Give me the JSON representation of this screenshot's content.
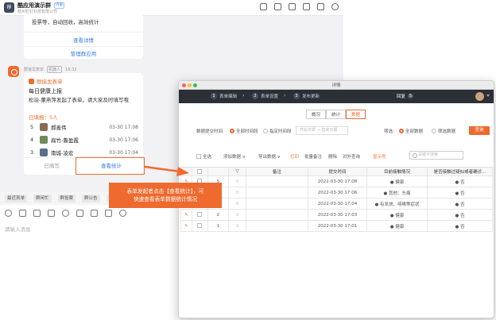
{
  "chat": {
    "group_avatar_text": "移",
    "group_name": "酷应用演示群",
    "group_badge": "内部",
    "company": "杭州钉钉科技有限公司",
    "top_card": {
      "desc": "投票等，自动回收，高效统计",
      "link1": "查看详情",
      "link2": "管理群应用"
    },
    "bot": {
      "name": "群接龙表单",
      "tag": "机器人",
      "time": "16:32"
    },
    "form_card": {
      "brand": "群接龙表单",
      "title": "每日健康上报",
      "desc": "松溢-董燕萍发起了表单，请大家及时填写哦",
      "filled": "已填报：5人",
      "entries": [
        {
          "num": "5",
          "name": "郝善伟",
          "time": "03-30 17:08",
          "color": "#8a6a55"
        },
        {
          "num": "4",
          "name": "扁竹-鲁盈霞",
          "time": "03-30 17:06",
          "color": "#6f8a5a"
        },
        {
          "num": "3",
          "name": "南城-凌宏",
          "time": "03-30 17:04",
          "color": "#5a6f8a"
        }
      ],
      "action_filled": "已填写",
      "action_stats": "查看统计"
    },
    "tools": [
      "最近表单",
      "群闲忙",
      "群投票",
      "群公告",
      "更多"
    ],
    "input_placeholder": "请输入消息"
  },
  "callout": {
    "line1": "表单发起者点击【查看统计】，可",
    "line2": "快速查看表单数据统计情况"
  },
  "window": {
    "title": "详情",
    "steps": [
      {
        "num": "1",
        "label": "表单编辑"
      },
      {
        "num": "2",
        "label": "表单设置"
      },
      {
        "num": "3",
        "label": "发布更新"
      }
    ],
    "reply_label": "回复",
    "reply_count": "5",
    "tabs": [
      "概况",
      "统计",
      "数据"
    ],
    "active_tab": "数据",
    "filter": {
      "time_label": "数据提交时间:",
      "all_time": "全部时间段",
      "custom_time": "指定时间段",
      "date_placeholder": "开始日期 → 结束日期",
      "filter_label": "筛选:",
      "all_data": "全部数据",
      "filtered_data": "筛选数据",
      "query": "查询"
    },
    "toolbar": {
      "select_all": "全选",
      "add": "添加数据 ∨",
      "export": "导出数据 ∨",
      "print": "打印",
      "batch_note": "批量备注",
      "delete": "删除",
      "external": "对外查询",
      "show_cols": "显示列",
      "search_placeholder": "关键字搜索"
    },
    "columns": [
      "",
      "",
      "",
      "",
      "备注",
      "提交时间",
      "目前接触情况",
      "是否接触过疑似或者确诊..."
    ],
    "rows": [
      {
        "seq": "5",
        "time": "2022-03-30 17:08",
        "status": "● 健康",
        "contact": "● 否"
      },
      {
        "seq": "4",
        "time": "2022-03-30 17:06",
        "status": "● 其他：头痛",
        "contact": "● 否"
      },
      {
        "seq": "3",
        "time": "2022-03-30 17:04",
        "status": "● 有发烧、咳嗽等症状",
        "contact": "● 否"
      },
      {
        "seq": "2",
        "time": "2022-03-30 17:03",
        "status": "● 健康",
        "contact": "● 否"
      },
      {
        "seq": "1",
        "time": "2022-03-30 17:01",
        "status": "● 健康",
        "contact": "● 否"
      }
    ]
  },
  "colors": {
    "accent": "#ee6a2e",
    "link": "#3a7ee6",
    "nav_bg": "#2b2f36"
  }
}
